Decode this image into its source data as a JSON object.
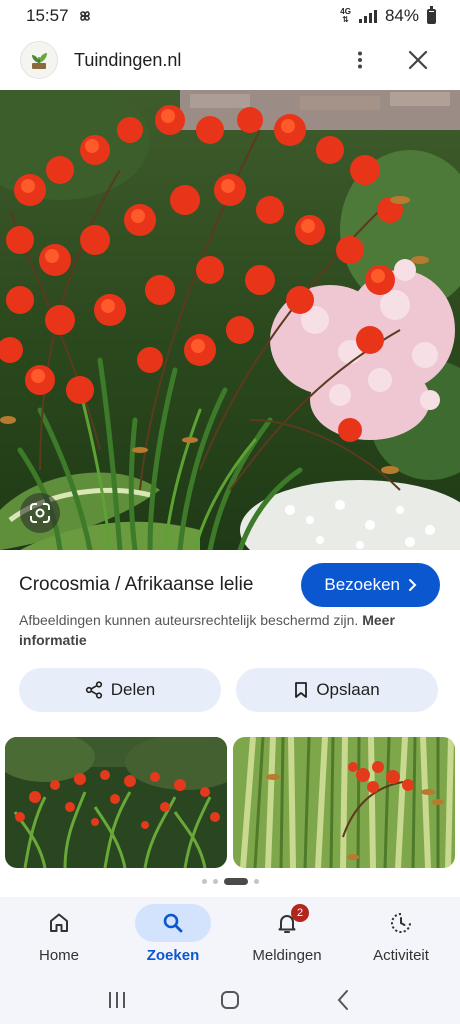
{
  "status_bar": {
    "time": "15:57",
    "network_top": "4G",
    "network_bottom": "⇅",
    "battery": "84%"
  },
  "header": {
    "site_name": "Tuindingen.nl",
    "more_icon": "more-vert-icon",
    "close_icon": "close-icon"
  },
  "hero": {
    "lens_icon": "lens-icon"
  },
  "result": {
    "title": "Crocosmia / Afrikaanse lelie",
    "visit_label": "Bezoeken",
    "copyright_text": "Afbeeldingen kunnen auteursrechtelijk beschermd zijn.",
    "more_info_label": "Meer informatie"
  },
  "actions": {
    "share_label": "Delen",
    "save_label": "Opslaan"
  },
  "bottom_nav": {
    "items": [
      {
        "label": "Home",
        "icon": "home-icon"
      },
      {
        "label": "Zoeken",
        "icon": "search-icon"
      },
      {
        "label": "Meldingen",
        "icon": "bell-icon",
        "badge": "2"
      },
      {
        "label": "Activiteit",
        "icon": "activity-icon"
      }
    ]
  },
  "colors": {
    "accent": "#0b57d0",
    "pill_bg": "#e8eef9",
    "badge": "#b3261e"
  }
}
